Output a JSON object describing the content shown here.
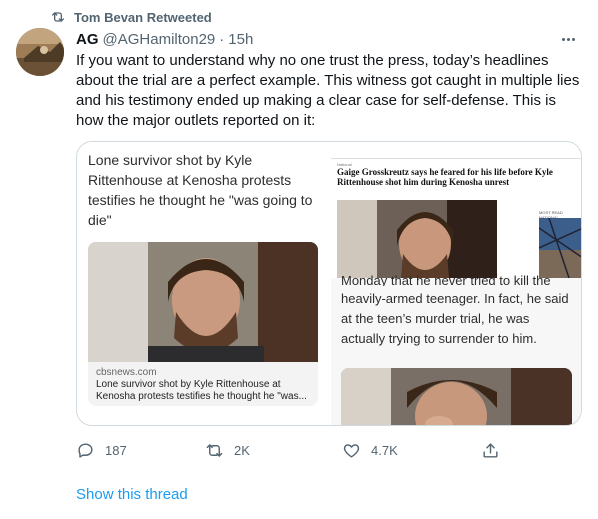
{
  "retweet": {
    "label": "Tom Bevan Retweeted"
  },
  "tweet": {
    "author_name": "AG",
    "author_handle": "@AGHamilton29",
    "separator": "·",
    "time": "15h",
    "text": "If you want to understand why no one trust the press, today’s headlines about the trial are a perfect example. This witness got caught in multiple lies and his testimony ended up making a clear case for self-defense. This is how the major outlets reported on it:"
  },
  "media": {
    "left": {
      "headline": "Lone survivor shot by Kyle Rittenhouse at Kenosha protests testifies he thought he \"was going to die\"",
      "link_domain": "cbsnews.com",
      "link_title": "Lone survivor shot by Kyle Rittenhouse at Kenosha protests testifies he thought he \"was..."
    },
    "right": {
      "section": "National",
      "headline": "Gaige Grosskreutz says he feared for his life before Kyle Rittenhouse shot him during Kenosha unrest",
      "side_label": "MOST READ NATIONAL",
      "body_cut": "Monday that he never tried to kill the",
      "body": "heavily-armed teenager. In fact, he said at the teen’s murder trial, he was actually trying to surrender to him."
    }
  },
  "actions": {
    "replies": "187",
    "retweets": "2K",
    "likes": "4.7K"
  },
  "show_thread": "Show this thread",
  "colors": {
    "accent": "#1d9bf0",
    "muted": "#536471",
    "text": "#0f1419",
    "border": "#cfd9de"
  },
  "icons": [
    "retweet-icon",
    "more-icon",
    "reply-icon",
    "like-icon",
    "share-icon"
  ]
}
